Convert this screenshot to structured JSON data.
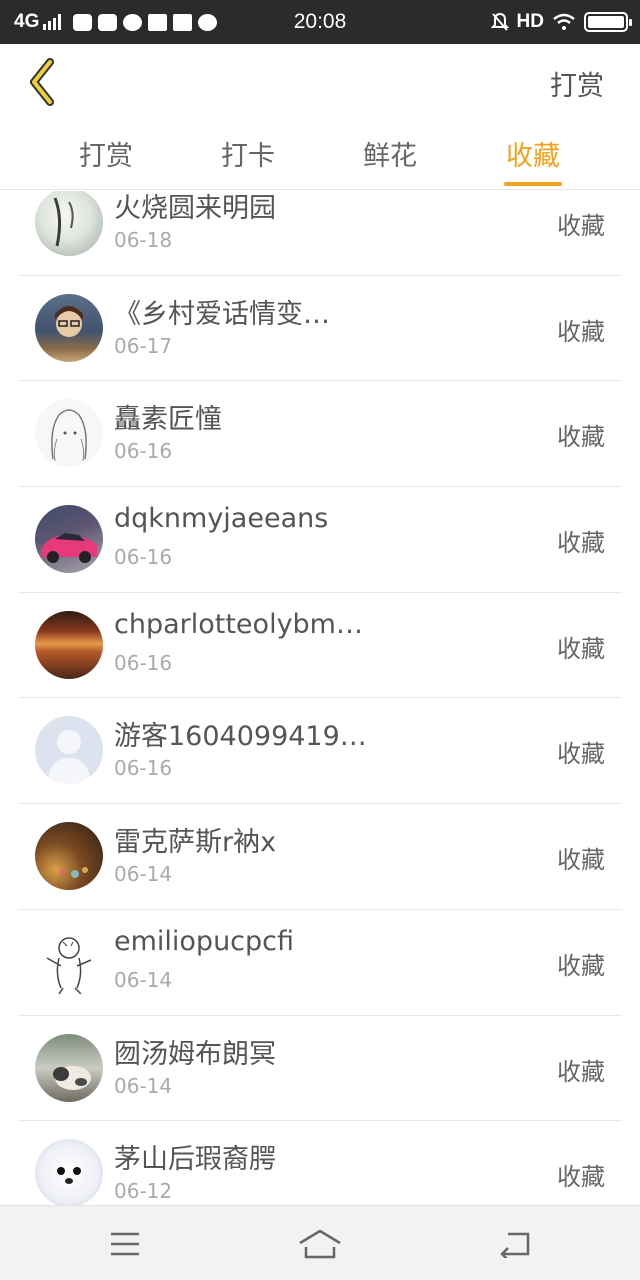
{
  "status_bar": {
    "network": "4G",
    "time": "20:08",
    "hd": "HD",
    "icons": [
      "signal-icon",
      "video-app-icon",
      "mail-icon",
      "browser-icon",
      "crown-icon",
      "crown-icon",
      "chat-icon",
      "mute-bell-icon",
      "wifi-icon",
      "battery-icon"
    ]
  },
  "header": {
    "back_icon": "chevron-left-icon",
    "action_label": "打赏",
    "accent_color": "#f0a31e"
  },
  "tabs": [
    {
      "label": "打赏",
      "active": false
    },
    {
      "label": "打卡",
      "active": false
    },
    {
      "label": "鲜花",
      "active": false
    },
    {
      "label": "收藏",
      "active": true
    }
  ],
  "list": [
    {
      "name": "火烧圆来明园",
      "date": "06-18",
      "action": "收藏",
      "avatar": "avatar-painting"
    },
    {
      "name": "《乡村爱话情变…",
      "date": "06-17",
      "action": "收藏",
      "avatar": "avatar-person"
    },
    {
      "name": "矗素匠憧",
      "date": "06-16",
      "action": "收藏",
      "avatar": "avatar-sketch-girl"
    },
    {
      "name": "dqknmyjaeeans",
      "date": "06-16",
      "action": "收藏",
      "avatar": "avatar-pink-car"
    },
    {
      "name": "chparlotteolybm…",
      "date": "06-16",
      "action": "收藏",
      "avatar": "avatar-sunset"
    },
    {
      "name": "游客1604099419…",
      "date": "06-16",
      "action": "收藏",
      "avatar": "avatar-default"
    },
    {
      "name": "雷克萨斯r衲x",
      "date": "06-14",
      "action": "收藏",
      "avatar": "avatar-bokeh"
    },
    {
      "name": "emiliopucpcfi",
      "date": "06-14",
      "action": "收藏",
      "avatar": "avatar-tiger-sketch"
    },
    {
      "name": "囫汤姆布朗冥",
      "date": "06-14",
      "action": "收藏",
      "avatar": "avatar-cat"
    },
    {
      "name": "茅山后瑕裔腭",
      "date": "06-12",
      "action": "收藏",
      "avatar": "avatar-seal"
    }
  ],
  "navbar": {
    "icons": [
      "menu-icon",
      "home-icon",
      "back-icon"
    ]
  }
}
